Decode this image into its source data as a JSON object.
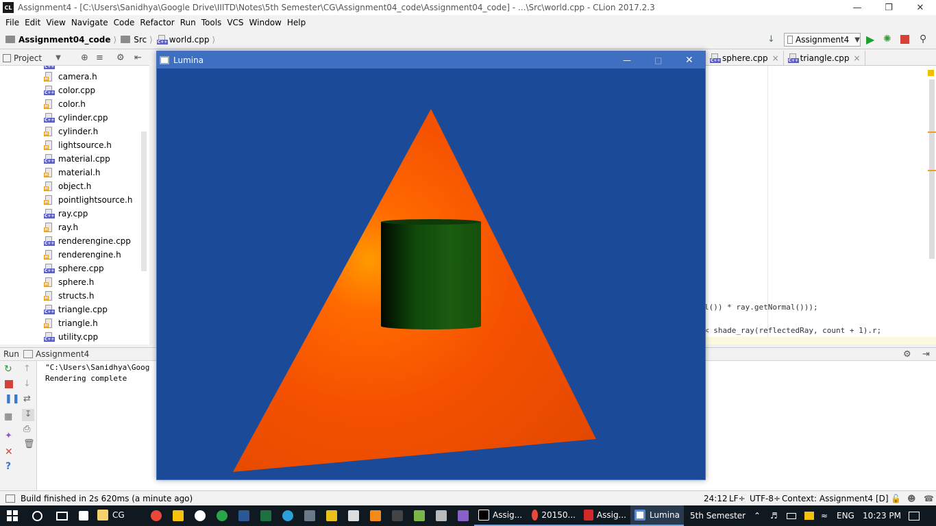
{
  "window": {
    "title": "Assignment4 - [C:\\Users\\Sanidhya\\Google Drive\\IIITD\\Notes\\5th Semester\\CG\\Assignment04_code\\Assignment04_code] - ...\\Src\\world.cpp - CLion 2017.2.3",
    "app_icon": "CL"
  },
  "menu": [
    "File",
    "Edit",
    "View",
    "Navigate",
    "Code",
    "Refactor",
    "Run",
    "Tools",
    "VCS",
    "Window",
    "Help"
  ],
  "breadcrumb": [
    "Assignment04_code",
    "Src",
    "world.cpp"
  ],
  "run_config": "Assignment4",
  "project_panel": {
    "title": "Project"
  },
  "project_files": [
    {
      "name": "camera.h",
      "type": "h"
    },
    {
      "name": "color.cpp",
      "type": "cpp"
    },
    {
      "name": "color.h",
      "type": "h"
    },
    {
      "name": "cylinder.cpp",
      "type": "cpp"
    },
    {
      "name": "cylinder.h",
      "type": "h"
    },
    {
      "name": "lightsource.h",
      "type": "h"
    },
    {
      "name": "material.cpp",
      "type": "cpp"
    },
    {
      "name": "material.h",
      "type": "h"
    },
    {
      "name": "object.h",
      "type": "h"
    },
    {
      "name": "pointlightsource.h",
      "type": "h"
    },
    {
      "name": "ray.cpp",
      "type": "cpp"
    },
    {
      "name": "ray.h",
      "type": "h"
    },
    {
      "name": "renderengine.cpp",
      "type": "cpp"
    },
    {
      "name": "renderengine.h",
      "type": "h"
    },
    {
      "name": "sphere.cpp",
      "type": "cpp"
    },
    {
      "name": "sphere.h",
      "type": "h"
    },
    {
      "name": "structs.h",
      "type": "h"
    },
    {
      "name": "triangle.cpp",
      "type": "cpp"
    },
    {
      "name": "triangle.h",
      "type": "h"
    },
    {
      "name": "utility.cpp",
      "type": "cpp"
    }
  ],
  "editor_tabs": [
    "sphere.cpp",
    "triangle.cpp"
  ],
  "code_lines": {
    "line1": "l()) * ray.getNormal()));",
    "line2": "< shade_ray(reflectedRay, count + 1).r;"
  },
  "run_panel": {
    "title": "Run",
    "config": "Assignment4",
    "output": [
      "\"C:\\Users\\Sanidhya\\Goog",
      "Rendering complete"
    ]
  },
  "status": {
    "message": "Build finished in 2s 620ms (a minute ago)",
    "position": "24:12",
    "line_sep": "LF÷",
    "encoding": "UTF-8÷",
    "context": "Context: Assignment4 [D]"
  },
  "lumina": {
    "title": "Lumina",
    "bg_color": "#1b4a98",
    "triangle_color": "#f25500",
    "cylinder_color": "#1a5a10"
  },
  "taskbar": {
    "windows": [
      {
        "label": "CG",
        "icon": "folder-icon"
      },
      {
        "label": "Assig...",
        "icon": "clion-icon"
      },
      {
        "label": "20150...",
        "icon": "chrome-icon"
      },
      {
        "label": "Assig...",
        "icon": "pdf-icon"
      },
      {
        "label": "Lumina",
        "icon": "lumina-icon"
      }
    ],
    "tray_folder": "5th Semester",
    "lang": "ENG",
    "time": "10:23 PM"
  }
}
